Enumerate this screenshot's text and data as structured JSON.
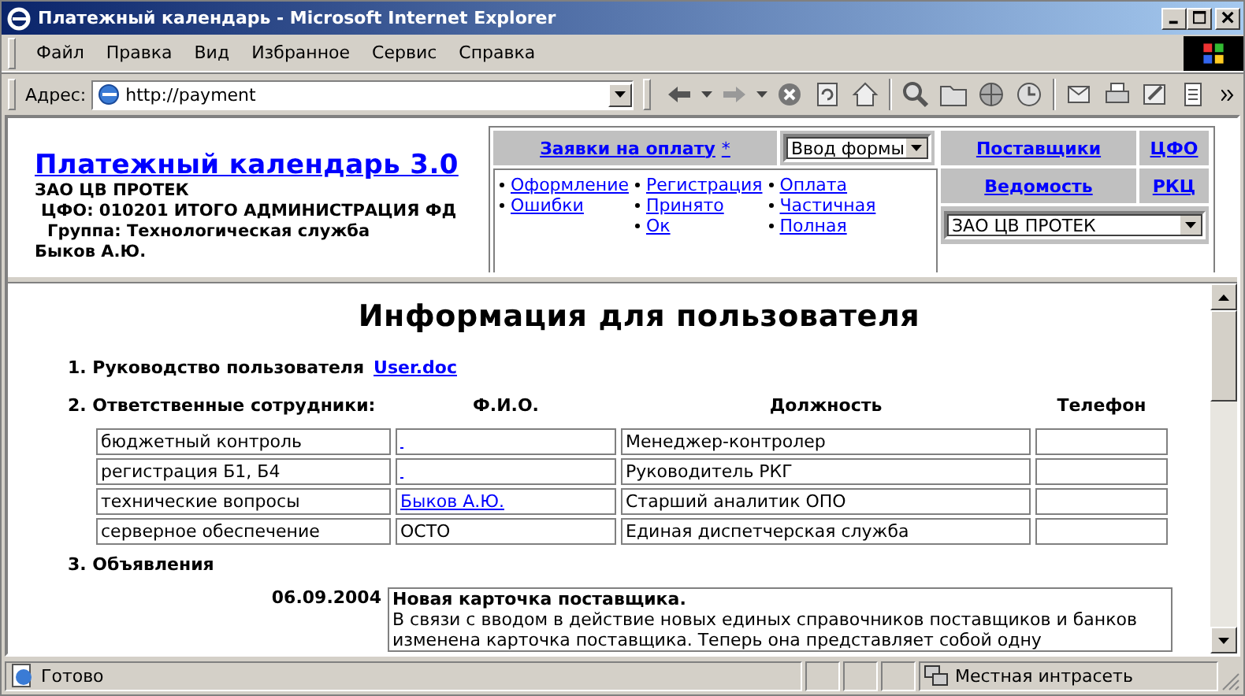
{
  "window": {
    "title": "Платежный календарь - Microsoft Internet Explorer"
  },
  "menu": [
    "Файл",
    "Правка",
    "Вид",
    "Избранное",
    "Сервис",
    "Справка"
  ],
  "address": {
    "label": "Адрес:",
    "value": "http://payment"
  },
  "header": {
    "title": "Платежный календарь 3.0",
    "org": "ЗАО ЦВ ПРОТЕК",
    "cfo": "ЦФО: 010201 ИТОГО АДМИНИСТРАЦИЯ ФД",
    "group": "Группа: Технологическая служба",
    "user": "Быков А.Ю."
  },
  "nav": {
    "requests": "Заявки на оплату",
    "star": "*",
    "form_select": "Ввод формы",
    "status_columns": [
      [
        "Оформление",
        "Ошибки"
      ],
      [
        "Регистрация",
        "Принято",
        "Ок"
      ],
      [
        "Оплата",
        "Частичная",
        "Полная"
      ]
    ],
    "links_top": [
      "Поставщики",
      "ЦФО"
    ],
    "links_bottom": [
      "Ведомость",
      "РКЦ"
    ],
    "org_select": "ЗАО ЦВ ПРОТЕК"
  },
  "content": {
    "heading": "Информация для пользователя",
    "manual": {
      "label": "1. Руководство пользователя",
      "link": "User.doc"
    },
    "staff": {
      "label": "2. Ответственные сотрудники:",
      "columns": [
        "Ф.И.О.",
        "Должность",
        "Телефон"
      ],
      "rows": [
        {
          "area": "бюджетный контроль",
          "name_is_link": true,
          "position": "Менеджер-контролер"
        },
        {
          "area": "регистрация Б1, Б4",
          "name_is_link": true,
          "position": "Руководитель РКГ"
        },
        {
          "area": "технические вопросы",
          "name": "Быков А.Ю.",
          "name_is_link": true,
          "position": "Старший аналитик ОПО"
        },
        {
          "area": "серверное обеспечение",
          "name": "ОСТО",
          "name_is_link": false,
          "position": "Единая диспетчерская служба"
        }
      ]
    },
    "news": {
      "label": "3. Объявления",
      "items": [
        {
          "date": "06.09.2004",
          "title": "Новая карточка поставщика.",
          "text": "В связи с вводом в действие новых единых справочников поставщиков и банков изменена карточка поставщика. Теперь она представляет собой одну"
        }
      ]
    }
  },
  "status_bar": {
    "text": "Готово",
    "zone": "Местная интрасеть"
  }
}
